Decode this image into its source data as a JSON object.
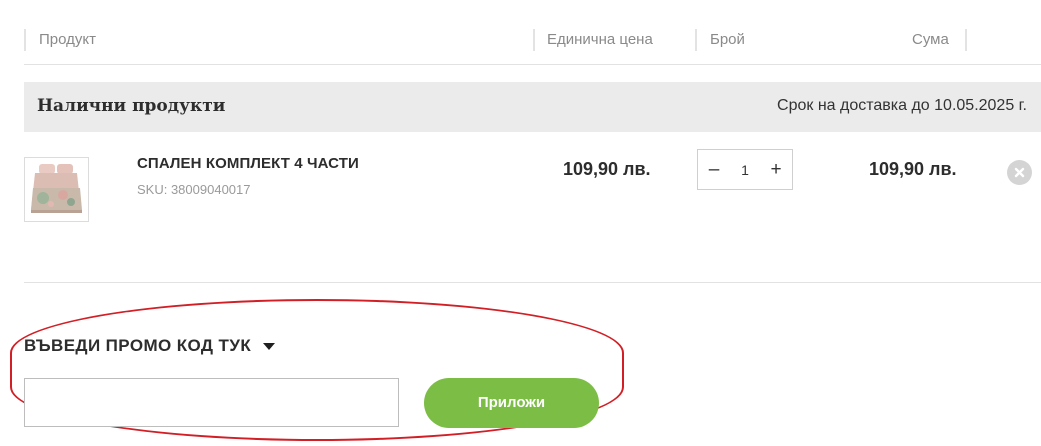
{
  "table_header": {
    "product": "Продукт",
    "unit_price": "Единична цена",
    "quantity": "Брой",
    "sum": "Сума"
  },
  "availability": {
    "title": "Налични продукти",
    "delivery": "Срок на доставка до 10.05.2025 г."
  },
  "product": {
    "image_icon": "bedding-set-photo",
    "name": "СПАЛЕН КОМПЛЕКТ 4 ЧАСТИ",
    "sku": "SKU: 38009040017",
    "unit_price": "109,90 лв.",
    "quantity": "1",
    "decrease_symbol": "–",
    "increase_symbol": "+",
    "line_total": "109,90 лв.",
    "remove_icon": "close-icon"
  },
  "promo": {
    "toggle_label": "ВЪВЕДИ ПРОМО КОД ТУК",
    "input_value": "",
    "apply_label": "Приложи"
  },
  "colors": {
    "accent_green": "#7bbd45",
    "highlight_red": "#d21f26",
    "bar_gray": "#ebebeb"
  }
}
